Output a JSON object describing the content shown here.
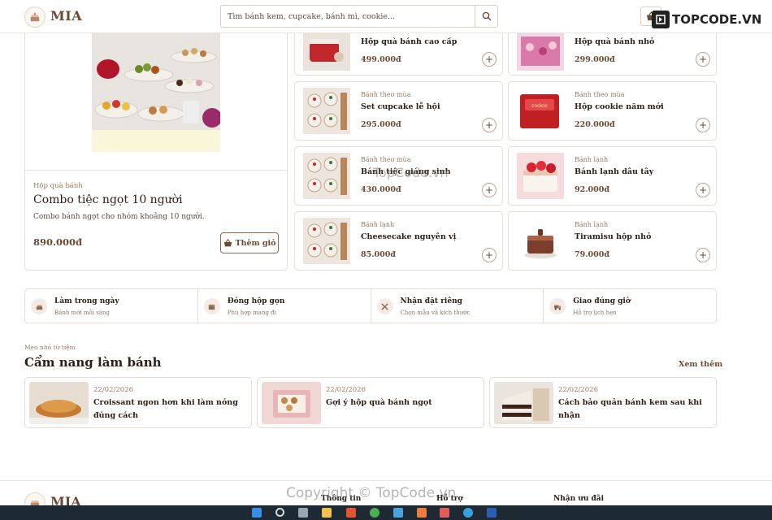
{
  "header": {
    "logo_text": "MIA",
    "search_placeholder": "Tìm bánh kem, cupcake, bánh mì, cookie...",
    "watermark_text": "TOPCODE.VN"
  },
  "featured": {
    "category": "Hộp quà bánh",
    "title": "Combo tiệc ngọt 10 người",
    "description": "Combo bánh ngọt cho nhóm khoảng 10 người.",
    "price": "890.000đ",
    "add_label": "Thêm giỏ"
  },
  "products": [
    {
      "category": "",
      "name": "Hộp quà bánh cao cấp",
      "price": "499.000đ"
    },
    {
      "category": "",
      "name": "Hộp quà bánh nhỏ",
      "price": "299.000đ"
    },
    {
      "category": "Bánh theo mùa",
      "name": "Set cupcake lễ hội",
      "price": "295.000đ"
    },
    {
      "category": "Bánh theo mùa",
      "name": "Hộp cookie năm mới",
      "price": "220.000đ"
    },
    {
      "category": "Bánh theo mùa",
      "name": "Bánh tiệc giáng sinh",
      "price": "430.000đ"
    },
    {
      "category": "Bánh lạnh",
      "name": "Bánh lạnh dâu tây",
      "price": "92.000đ"
    },
    {
      "category": "Bánh lạnh",
      "name": "Cheesecake nguyên vị",
      "price": "85.000đ"
    },
    {
      "category": "Bánh lạnh",
      "name": "Tiramisu hộp nhỏ",
      "price": "79.000đ"
    }
  ],
  "features": [
    {
      "title": "Làm trong ngày",
      "sub": "Bánh mới mỗi sáng",
      "icon": "cake-icon"
    },
    {
      "title": "Đóng hộp gọn",
      "sub": "Phù hợp mang đi",
      "icon": "box-icon"
    },
    {
      "title": "Nhận đặt riêng",
      "sub": "Chọn mẫu và kích thước",
      "icon": "tools-icon"
    },
    {
      "title": "Giao đúng giờ",
      "sub": "Hỗ trợ lịch hẹn",
      "icon": "truck-icon"
    }
  ],
  "blog": {
    "kicker": "Mẹo nhỏ từ tiệm",
    "title": "Cẩm nang làm bánh",
    "see_more": "Xem thêm",
    "posts": [
      {
        "date": "22/02/2026",
        "title": "Croissant ngon hơn khi làm nóng đúng cách"
      },
      {
        "date": "22/02/2026",
        "title": "Gợi ý hộp quà bánh ngọt"
      },
      {
        "date": "22/02/2026",
        "title": "Cách bảo quản bánh kem sau khi nhận"
      }
    ]
  },
  "footer": {
    "logo_text": "MIA",
    "col1": "Thông tin",
    "col2": "Hỗ trợ",
    "col3": "Nhận ưu đãi",
    "copyright": "Copyright © TopCode.vn",
    "center_watermark": "TopCode.vn"
  },
  "colors": {
    "accent": "#6b4a33",
    "muted": "#9a7a62",
    "border": "#e6ddd4"
  }
}
